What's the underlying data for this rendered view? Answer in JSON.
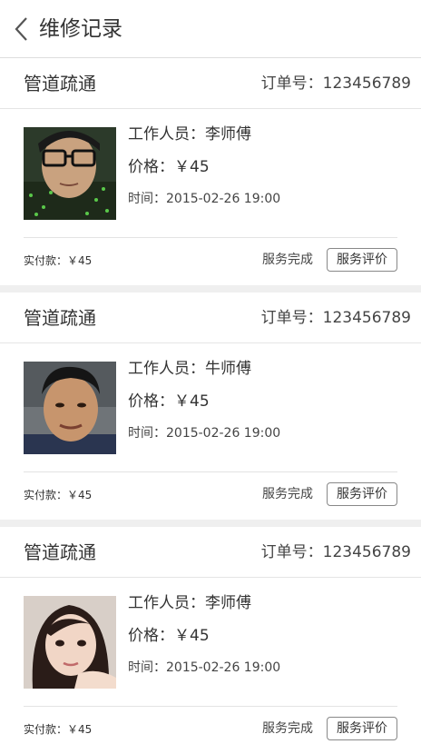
{
  "header": {
    "back_icon": "chevron-left-icon",
    "title": "维修记录"
  },
  "records": [
    {
      "service_type": "管道疏通",
      "order_no": "订单号：123456789",
      "worker": "工作人员：李师傅",
      "price": "价格：￥45",
      "time": "时间：2015-02-26 19:00",
      "paid": "实付款：￥45",
      "status": "服务完成",
      "review_label": "服务评价"
    },
    {
      "service_type": "管道疏通",
      "order_no": "订单号：123456789",
      "worker": "工作人员：牛师傅",
      "price": "价格：￥45",
      "time": "时间：2015-02-26 19:00",
      "paid": "实付款：￥45",
      "status": "服务完成",
      "review_label": "服务评价"
    },
    {
      "service_type": "管道疏通",
      "order_no": "订单号：123456789",
      "worker": "工作人员：李师傅",
      "price": "价格：￥45",
      "time": "时间：2015-02-26 19:00",
      "paid": "实付款：￥45",
      "status": "服务完成",
      "review_label": "服务评价"
    }
  ],
  "colors": {
    "background": "#efefef",
    "card": "#ffffff",
    "text": "#333333",
    "button_border": "#888888"
  }
}
